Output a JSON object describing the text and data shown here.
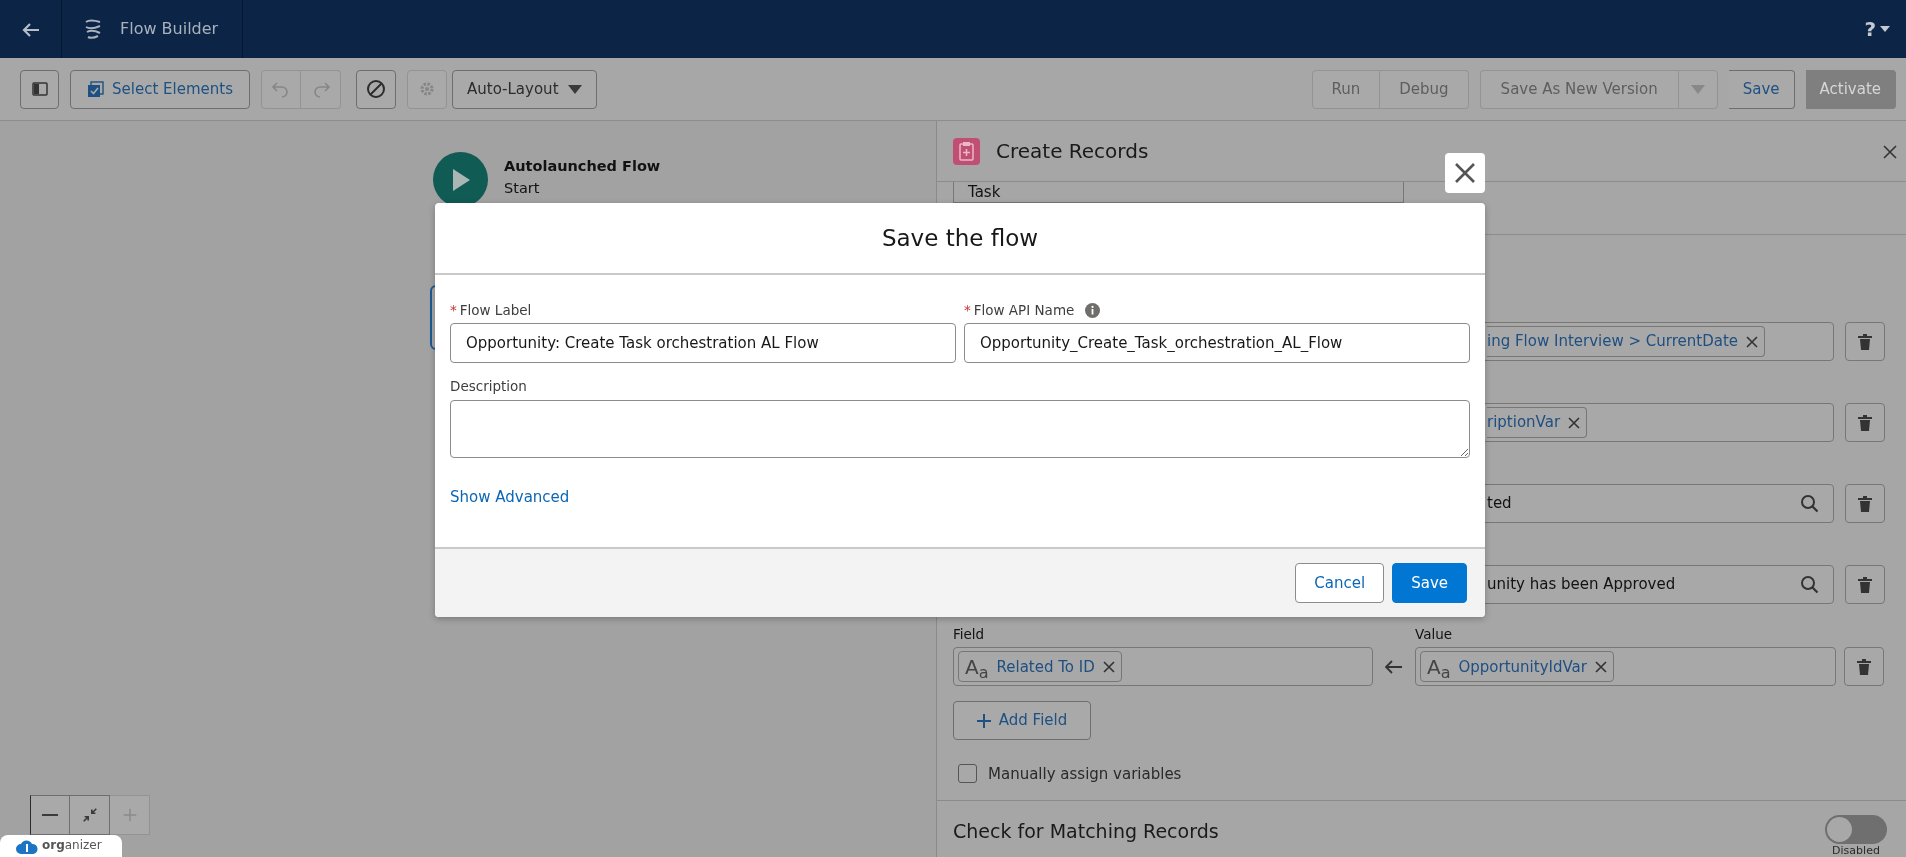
{
  "header": {
    "title": "Flow Builder",
    "help": "?"
  },
  "toolbar": {
    "select_elements": "Select Elements",
    "layout": "Auto-Layout",
    "icon_buttons": [
      {
        "kind": "undo",
        "disabled": true
      },
      {
        "kind": "redo",
        "disabled": true
      },
      {
        "kind": "block",
        "disabled": false
      },
      {
        "kind": "gear",
        "disabled": true
      }
    ],
    "button_groups": [
      {
        "buttons": [
          {
            "label": "Run",
            "disabled": true,
            "kind": "neutral"
          },
          {
            "label": "Debug",
            "disabled": true,
            "kind": "neutral"
          }
        ]
      },
      {
        "buttons": [
          {
            "label": "Save As New Version",
            "disabled": true,
            "kind": "menu"
          }
        ]
      },
      {
        "buttons": [
          {
            "label": "Save",
            "disabled": false,
            "kind": "neutral"
          }
        ]
      },
      {
        "buttons": [
          {
            "label": "Activate",
            "disabled": true,
            "kind": "brand"
          }
        ]
      }
    ]
  },
  "canvas": {
    "start_node": {
      "title": "Autolaunched Flow",
      "subtitle": "Start"
    },
    "zoom_controls": [
      {
        "kind": "zoom-out",
        "disabled": false
      },
      {
        "kind": "fit",
        "disabled": false
      },
      {
        "kind": "zoom-in",
        "disabled": true
      }
    ],
    "badge": "**org**anizer"
  },
  "panel": {
    "title": "Create Records",
    "object": "Task",
    "rows": [
      {
        "kind": "pill",
        "value": "ing Flow Interview > CurrentDate"
      },
      {
        "kind": "pill",
        "value": "riptionVar"
      },
      {
        "kind": "lookup",
        "value": "ted"
      },
      {
        "kind": "lookup",
        "value": "unity has been Approved"
      }
    ],
    "field_row": {
      "field_label": "Field",
      "value_label": "Value",
      "field_type_glyph": "A$_{a}$",
      "field": "Related To ID",
      "value_type_glyph": "A$_{a}$",
      "value": "OpportunityIdVar"
    },
    "add_field": "Add Field",
    "manual_assign": {
      "label": "Manually assign variables",
      "checked": false
    },
    "matching": {
      "title": "Check for Matching Records",
      "on": false,
      "state_label": "Disabled"
    }
  },
  "modal": {
    "title": "Save the flow",
    "fields": [
      {
        "required_mark": "*",
        "label": "Flow Label",
        "info": false,
        "value": "Opportunity: Create Task orchestration AL Flow"
      },
      {
        "required_mark": "*",
        "label": "Flow API Name",
        "info": true,
        "value": "Opportunity_Create_Task_orchestration_AL_Flow"
      }
    ],
    "description": {
      "label": "Description"
    },
    "show_advanced": "Show Advanced",
    "buttons": [
      {
        "label": "Cancel",
        "kind": "neutral"
      },
      {
        "label": "Save",
        "kind": "brand"
      }
    ]
  }
}
